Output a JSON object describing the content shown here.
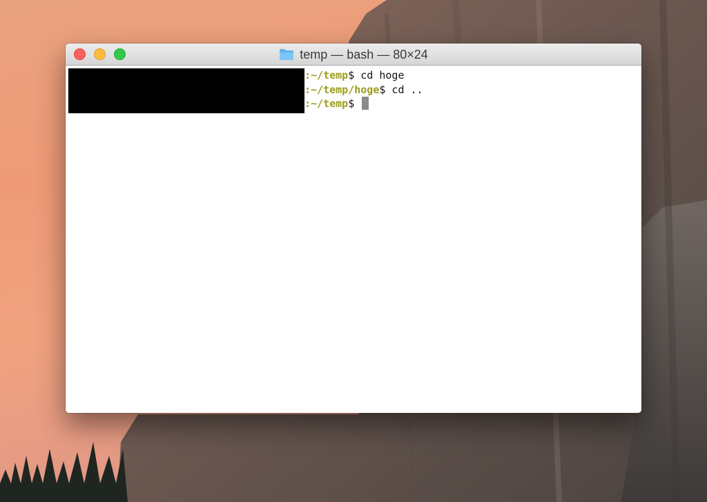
{
  "window": {
    "title": "temp — bash — 80×24",
    "icon": "folder-icon"
  },
  "terminal": {
    "lines": [
      {
        "path": ":~/temp",
        "symbol": "$",
        "command": " cd hoge"
      },
      {
        "path": ":~/temp/hoge",
        "symbol": "$",
        "command": " cd .."
      },
      {
        "path": ":~/temp",
        "symbol": "$",
        "command": " "
      }
    ]
  },
  "colors": {
    "prompt_path": "#9c9e1e",
    "close": "#fc605c",
    "minimize": "#fdbc40",
    "zoom": "#34c84a"
  }
}
